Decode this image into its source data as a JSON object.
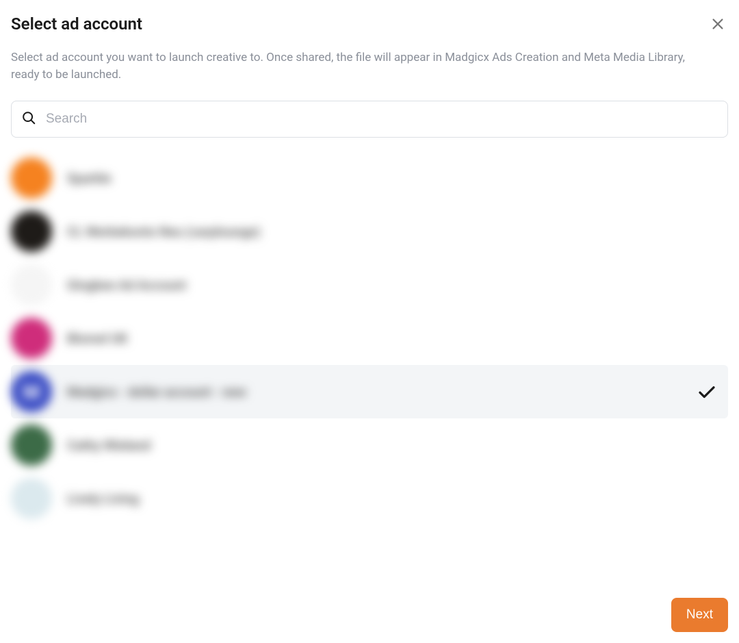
{
  "header": {
    "title": "Select ad account"
  },
  "description": "Select ad account you want to launch creative to. Once shared, the file will appear in Madgicx Ads Creation and Meta Media Library, ready to be launched.",
  "search": {
    "placeholder": "Search",
    "value": ""
  },
  "accounts": [
    {
      "name": "Sparkle",
      "avatar_class": "av-orange",
      "avatar_letter": "",
      "selected": false,
      "blurred": true
    },
    {
      "name": "CL Werbekonto Neu (carplounge)",
      "avatar_class": "av-dark",
      "avatar_letter": "",
      "selected": false,
      "blurred": true
    },
    {
      "name": "Gingbee Ad Account",
      "avatar_class": "av-white",
      "avatar_letter": "",
      "selected": false,
      "blurred": true
    },
    {
      "name": "Blomel UK",
      "avatar_class": "av-pink",
      "avatar_letter": "",
      "selected": false,
      "blurred": true
    },
    {
      "name": "Madgicx - dollar account - new",
      "avatar_class": "av-blue",
      "avatar_letter": "M",
      "selected": true,
      "blurred": true
    },
    {
      "name": "Cathy Wieland",
      "avatar_class": "av-green",
      "avatar_letter": "",
      "selected": false,
      "blurred": true
    },
    {
      "name": "Lively Living",
      "avatar_class": "av-light",
      "avatar_letter": "",
      "selected": false,
      "blurred": true
    }
  ],
  "buttons": {
    "next_label": "Next"
  },
  "colors": {
    "primary": "#ea7b2e",
    "text_muted": "#8a8f99",
    "border": "#dcdfe4",
    "selected_bg": "#f3f5f7"
  }
}
